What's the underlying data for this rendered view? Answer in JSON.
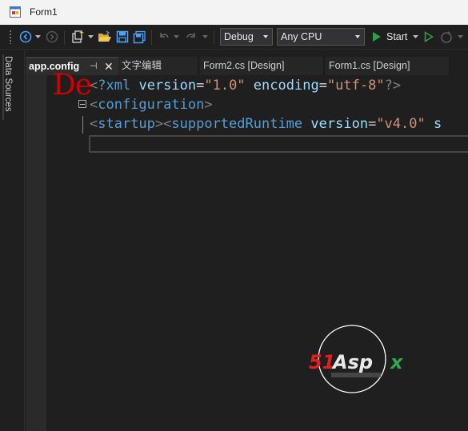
{
  "window": {
    "title": "Form1"
  },
  "toolbar": {
    "configuration": "Debug",
    "platform": "Any CPU",
    "start_label": "Start"
  },
  "side_panel": {
    "label": "Data Sources"
  },
  "tabs": [
    {
      "label": "app.config",
      "active": true
    },
    {
      "label": "文字编辑",
      "active": false
    },
    {
      "label": "Form2.cs [Design]",
      "active": false
    },
    {
      "label": "Form1.cs [Design]",
      "active": false
    }
  ],
  "editor": {
    "overlay_text": "De",
    "lines": [
      {
        "open": "<",
        "decl": "?xml",
        "a1": "version",
        "eq1": "=",
        "v1": "\"1.0\"",
        "a2": "encoding",
        "eq2": "=",
        "v2": "\"utf-8\"",
        "close": "?>"
      },
      {
        "open": "<",
        "tag": "configuration",
        "close": ">"
      },
      {
        "open1": "<",
        "tag1": "startup",
        "close1": "><",
        "tag2": "supportedRuntime",
        "attr": "version",
        "eq": "=",
        "val": "\"v4.0\"",
        "rest": "s"
      }
    ]
  },
  "watermark": {
    "text": "51Aspx"
  },
  "colors": {
    "editor_bg": "#1f1f1f",
    "xml_tag": "#569cd6",
    "xml_attr": "#9cdcfe",
    "xml_string": "#ce9178",
    "xml_bracket": "#808080",
    "start_green": "#2ea043",
    "overlay_red": "#d40000"
  }
}
